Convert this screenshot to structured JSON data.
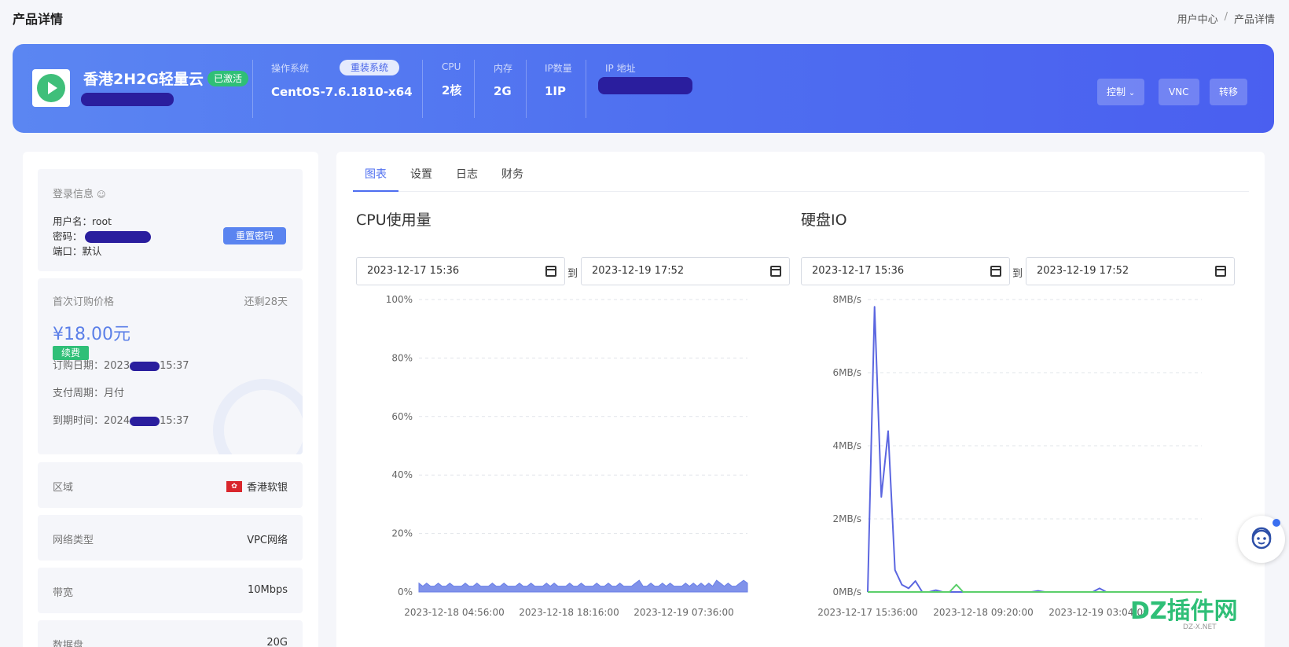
{
  "header": {
    "title": "产品详情",
    "breadcrumb": [
      "用户中心",
      "/",
      "产品详情"
    ]
  },
  "banner": {
    "product_name": "香港2H2G轻量云",
    "status_badge": "已激活",
    "os_label": "操作系统",
    "reinstall_label": "重装系统",
    "os_value": "CentOS-7.6.1810-x64",
    "cpu_label": "CPU",
    "cpu_value": "2核",
    "mem_label": "内存",
    "mem_value": "2G",
    "ipcount_label": "IP数量",
    "ipcount_value": "1IP",
    "ip_label": "IP 地址",
    "buttons": {
      "control": "控制",
      "vnc": "VNC",
      "transfer": "转移"
    }
  },
  "login": {
    "title": "登录信息",
    "username_label": "用户名：",
    "username_value": "root",
    "password_label": "密码：",
    "port_label": "端口：",
    "port_value": "默认",
    "reset_button": "重置密码"
  },
  "billing": {
    "first_price_label": "首次订购价格",
    "remaining": "还剩28天",
    "price": "¥18.00元",
    "renew_label": "续费",
    "order_date_label": "订购日期：",
    "order_date_prefix": "2023",
    "order_date_suffix": "15:37",
    "cycle_label": "支付周期：",
    "cycle_value": "月付",
    "expire_label": "到期时间：",
    "expire_prefix": "2024",
    "expire_suffix": "15:37"
  },
  "info_rows": [
    {
      "label": "区域",
      "value": "香港软银",
      "flag": true
    },
    {
      "label": "网络类型",
      "value": "VPC网络"
    },
    {
      "label": "带宽",
      "value": "10Mbps"
    },
    {
      "label": "数据盘",
      "value": "20G"
    }
  ],
  "tabs": [
    "图表",
    "设置",
    "日志",
    "财务"
  ],
  "range": {
    "start": "2023-12-17 15:36",
    "sep": "到",
    "end": "2023-12-19 17:52"
  },
  "chart_data": [
    {
      "type": "area",
      "title": "CPU使用量",
      "ylabel": "",
      "y_ticks": [
        "100%",
        "80%",
        "60%",
        "40%",
        "20%",
        "0%"
      ],
      "ylim": [
        0,
        100
      ],
      "x_ticks": [
        "2023-12-18 04:56:00",
        "2023-12-18 18:16:00",
        "2023-12-19 07:36:00"
      ],
      "color": "#6a7fe6",
      "series": [
        {
          "values": [
            3,
            2,
            3,
            2,
            2,
            3,
            2,
            2,
            3,
            2,
            2,
            2,
            3,
            2,
            2,
            3,
            2,
            2,
            2,
            3,
            2,
            2,
            3,
            2,
            2,
            2,
            3,
            2,
            2,
            3,
            2,
            2,
            2,
            3,
            2,
            3,
            2,
            2,
            2,
            3,
            2,
            2,
            3,
            2,
            2,
            2,
            3,
            2,
            2,
            3,
            2,
            2,
            3,
            2,
            2,
            2,
            3,
            4,
            2,
            2,
            3,
            2,
            2,
            3,
            2,
            3,
            2,
            2,
            2,
            3,
            2,
            3,
            2,
            3,
            2,
            3,
            2,
            4,
            3,
            2,
            3,
            2,
            2,
            3,
            4,
            3
          ]
        }
      ]
    },
    {
      "type": "line",
      "title": "硬盘IO",
      "ylabel": "",
      "y_ticks": [
        "8MB/s",
        "6MB/s",
        "4MB/s",
        "2MB/s",
        "0MB/s"
      ],
      "ylim": [
        0,
        8
      ],
      "x_ticks": [
        "2023-12-17 15:36:00",
        "2023-12-18 09:20:00",
        "2023-12-19 03:04:00"
      ],
      "series": [
        {
          "name": "",
          "color": "#5b66e0",
          "values": [
            0,
            7.8,
            2.6,
            4.4,
            0.6,
            0.2,
            0.1,
            0.3,
            0,
            0,
            0.05,
            0,
            0,
            0,
            0,
            0,
            0,
            0,
            0,
            0,
            0,
            0,
            0,
            0,
            0,
            0.03,
            0,
            0,
            0,
            0,
            0,
            0,
            0,
            0,
            0.1,
            0,
            0,
            0,
            0,
            0,
            0,
            0,
            0,
            0,
            0,
            0,
            0,
            0,
            0,
            0
          ]
        },
        {
          "name": "",
          "color": "#5bcf6a",
          "values": [
            0,
            0,
            0,
            0,
            0,
            0,
            0,
            0,
            0,
            0,
            0,
            0,
            0,
            0.2,
            0,
            0,
            0,
            0,
            0,
            0,
            0,
            0,
            0,
            0,
            0,
            0,
            0,
            0,
            0,
            0,
            0,
            0,
            0,
            0,
            0,
            0,
            0,
            0,
            0,
            0,
            0,
            0,
            0,
            0,
            0,
            0,
            0,
            0,
            0,
            0
          ]
        }
      ]
    }
  ],
  "watermark": {
    "logo": "DZ插件网",
    "sub": "DZ-X.NET"
  }
}
